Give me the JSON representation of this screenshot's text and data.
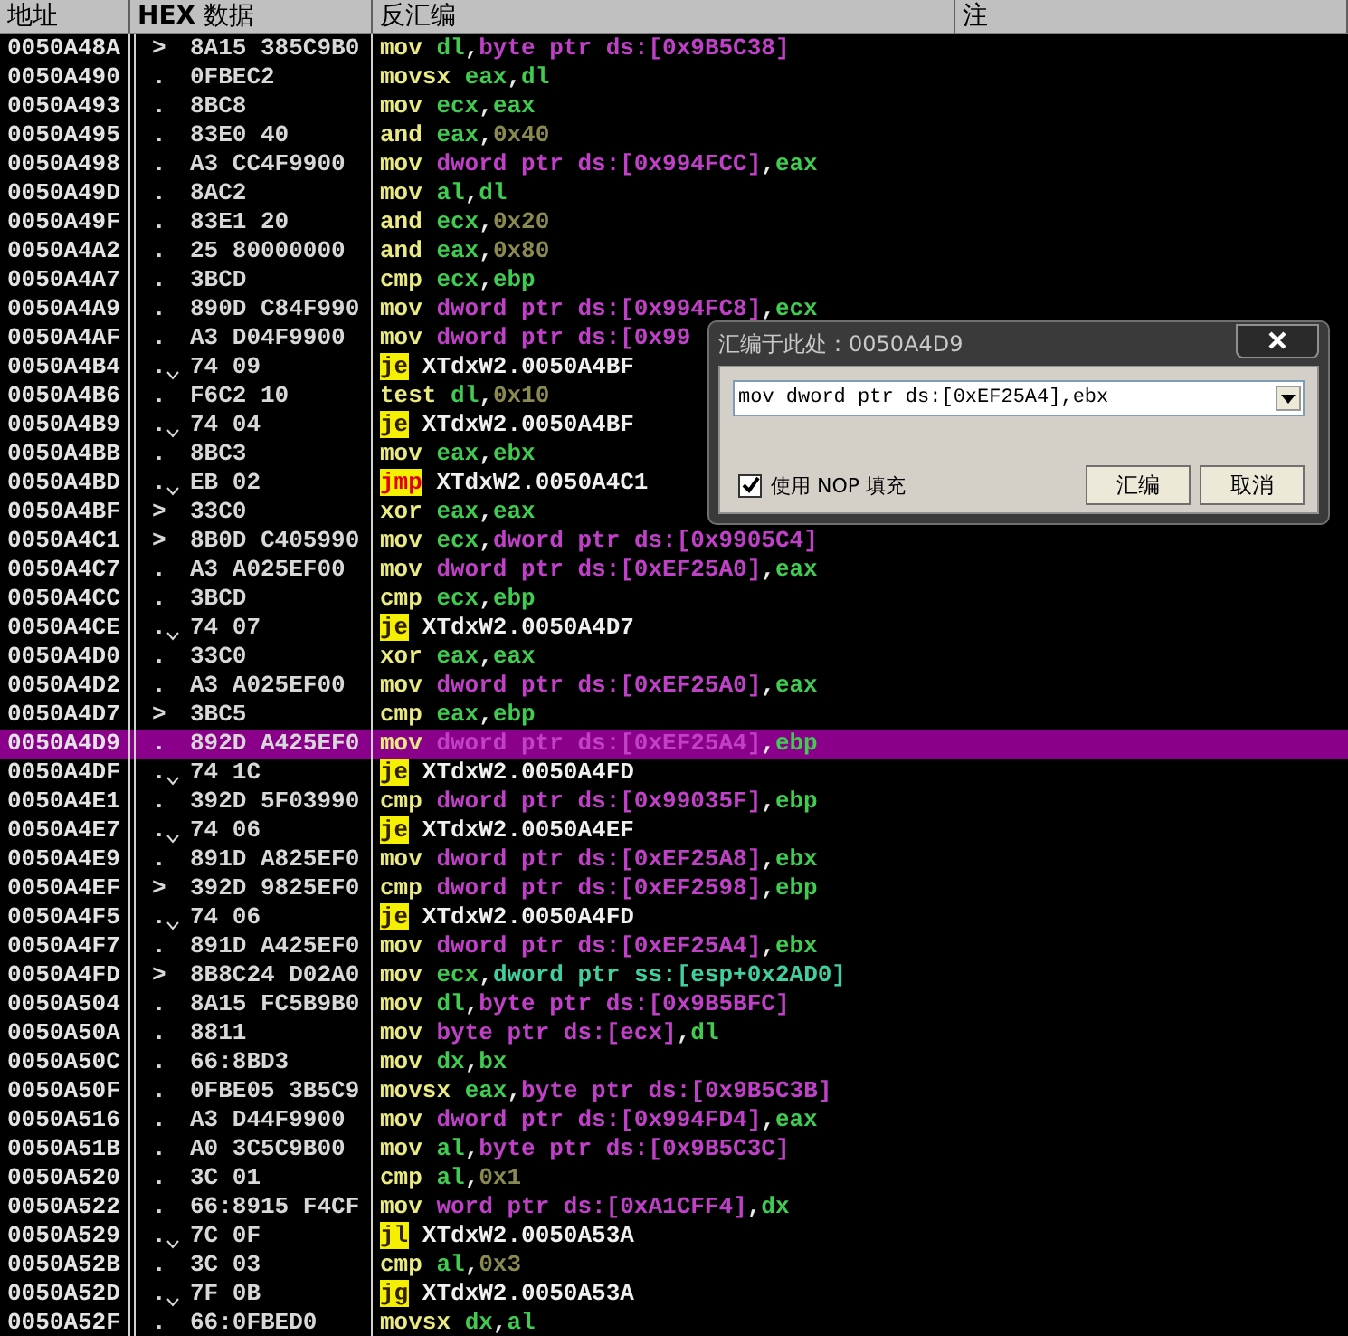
{
  "columns": [
    {
      "label": "地址"
    },
    {
      "label": "**HEX** 数据"
    },
    {
      "label": "反汇编"
    },
    {
      "label": "注"
    }
  ],
  "rows": [
    {
      "addr": "0050A48A",
      "marker": ">",
      "branch": false,
      "hex": "8A15 385C9B0",
      "selected": false,
      "asm": [
        {
          "kind": "mn",
          "text": "mov"
        },
        {
          "kind": "reg",
          "text": " dl"
        },
        {
          "kind": "p",
          "text": ","
        },
        {
          "kind": "mem",
          "text": "byte ptr ds:[0x9B5C38]"
        }
      ]
    },
    {
      "addr": "0050A490",
      "marker": ".",
      "branch": false,
      "hex": "0FBEC2",
      "selected": false,
      "asm": [
        {
          "kind": "mn",
          "text": "movsx"
        },
        {
          "kind": "reg",
          "text": " eax"
        },
        {
          "kind": "p",
          "text": ","
        },
        {
          "kind": "reg",
          "text": "dl"
        }
      ]
    },
    {
      "addr": "0050A493",
      "marker": ".",
      "branch": false,
      "hex": "8BC8",
      "selected": false,
      "asm": [
        {
          "kind": "mn",
          "text": "mov"
        },
        {
          "kind": "reg",
          "text": " ecx"
        },
        {
          "kind": "p",
          "text": ","
        },
        {
          "kind": "reg",
          "text": "eax"
        }
      ]
    },
    {
      "addr": "0050A495",
      "marker": ".",
      "branch": false,
      "hex": "83E0 40",
      "selected": false,
      "asm": [
        {
          "kind": "mn",
          "text": "and"
        },
        {
          "kind": "reg",
          "text": " eax"
        },
        {
          "kind": "p",
          "text": ","
        },
        {
          "kind": "imm",
          "text": "0x40"
        }
      ]
    },
    {
      "addr": "0050A498",
      "marker": ".",
      "branch": false,
      "hex": "A3 CC4F9900",
      "selected": false,
      "asm": [
        {
          "kind": "mn",
          "text": "mov"
        },
        {
          "kind": "mem",
          "text": " dword ptr ds:[0x994FCC]"
        },
        {
          "kind": "p",
          "text": ","
        },
        {
          "kind": "reg",
          "text": "eax"
        }
      ]
    },
    {
      "addr": "0050A49D",
      "marker": ".",
      "branch": false,
      "hex": "8AC2",
      "selected": false,
      "asm": [
        {
          "kind": "mn",
          "text": "mov"
        },
        {
          "kind": "reg",
          "text": " al"
        },
        {
          "kind": "p",
          "text": ","
        },
        {
          "kind": "reg",
          "text": "dl"
        }
      ]
    },
    {
      "addr": "0050A49F",
      "marker": ".",
      "branch": false,
      "hex": "83E1 20",
      "selected": false,
      "asm": [
        {
          "kind": "mn",
          "text": "and"
        },
        {
          "kind": "reg",
          "text": " ecx"
        },
        {
          "kind": "p",
          "text": ","
        },
        {
          "kind": "imm",
          "text": "0x20"
        }
      ]
    },
    {
      "addr": "0050A4A2",
      "marker": ".",
      "branch": false,
      "hex": "25 80000000",
      "selected": false,
      "asm": [
        {
          "kind": "mn",
          "text": "and"
        },
        {
          "kind": "reg",
          "text": " eax"
        },
        {
          "kind": "p",
          "text": ","
        },
        {
          "kind": "imm",
          "text": "0x80"
        }
      ]
    },
    {
      "addr": "0050A4A7",
      "marker": ".",
      "branch": false,
      "hex": "3BCD",
      "selected": false,
      "asm": [
        {
          "kind": "mn",
          "text": "cmp"
        },
        {
          "kind": "reg",
          "text": " ecx"
        },
        {
          "kind": "p",
          "text": ","
        },
        {
          "kind": "reg",
          "text": "ebp"
        }
      ]
    },
    {
      "addr": "0050A4A9",
      "marker": ".",
      "branch": false,
      "hex": "890D C84F990",
      "selected": false,
      "asm": [
        {
          "kind": "mn",
          "text": "mov"
        },
        {
          "kind": "mem",
          "text": " dword ptr ds:[0x994FC8]"
        },
        {
          "kind": "p",
          "text": ","
        },
        {
          "kind": "reg",
          "text": "ecx"
        }
      ]
    },
    {
      "addr": "0050A4AF",
      "marker": ".",
      "branch": false,
      "hex": "A3 D04F9900",
      "selected": false,
      "asm": [
        {
          "kind": "mn",
          "text": "mov"
        },
        {
          "kind": "mem",
          "text": " dword ptr ds:[0x99"
        }
      ]
    },
    {
      "addr": "0050A4B4",
      "marker": ".",
      "branch": true,
      "hex": "74 09",
      "selected": false,
      "asm": [
        {
          "kind": "jcc",
          "text": "je"
        },
        {
          "kind": "tgt",
          "text": " XTdxW2.0050A4BF"
        }
      ]
    },
    {
      "addr": "0050A4B6",
      "marker": ".",
      "branch": false,
      "hex": "F6C2 10",
      "selected": false,
      "asm": [
        {
          "kind": "mn",
          "text": "test"
        },
        {
          "kind": "reg",
          "text": " dl"
        },
        {
          "kind": "p",
          "text": ","
        },
        {
          "kind": "imm",
          "text": "0x10"
        }
      ]
    },
    {
      "addr": "0050A4B9",
      "marker": ".",
      "branch": true,
      "hex": "74 04",
      "selected": false,
      "asm": [
        {
          "kind": "jcc",
          "text": "je"
        },
        {
          "kind": "tgt",
          "text": " XTdxW2.0050A4BF"
        }
      ]
    },
    {
      "addr": "0050A4BB",
      "marker": ".",
      "branch": false,
      "hex": "8BC3",
      "selected": false,
      "asm": [
        {
          "kind": "mn",
          "text": "mov"
        },
        {
          "kind": "reg",
          "text": " eax"
        },
        {
          "kind": "p",
          "text": ","
        },
        {
          "kind": "reg",
          "text": "ebx"
        }
      ]
    },
    {
      "addr": "0050A4BD",
      "marker": ".",
      "branch": true,
      "hex": "EB 02",
      "selected": false,
      "asm": [
        {
          "kind": "jmp",
          "text": "jmp"
        },
        {
          "kind": "tgt",
          "text": " XTdxW2.0050A4C1"
        }
      ]
    },
    {
      "addr": "0050A4BF",
      "marker": ">",
      "branch": false,
      "hex": "33C0",
      "selected": false,
      "asm": [
        {
          "kind": "mn",
          "text": "xor"
        },
        {
          "kind": "reg",
          "text": " eax"
        },
        {
          "kind": "p",
          "text": ","
        },
        {
          "kind": "reg",
          "text": "eax"
        }
      ]
    },
    {
      "addr": "0050A4C1",
      "marker": ">",
      "branch": false,
      "hex": "8B0D C405990",
      "selected": false,
      "asm": [
        {
          "kind": "mn",
          "text": "mov"
        },
        {
          "kind": "reg",
          "text": " ecx"
        },
        {
          "kind": "p",
          "text": ","
        },
        {
          "kind": "mem",
          "text": "dword ptr ds:[0x9905C4]"
        }
      ]
    },
    {
      "addr": "0050A4C7",
      "marker": ".",
      "branch": false,
      "hex": "A3 A025EF00",
      "selected": false,
      "asm": [
        {
          "kind": "mn",
          "text": "mov"
        },
        {
          "kind": "mem",
          "text": " dword ptr ds:[0xEF25A0]"
        },
        {
          "kind": "p",
          "text": ","
        },
        {
          "kind": "reg",
          "text": "eax"
        }
      ]
    },
    {
      "addr": "0050A4CC",
      "marker": ".",
      "branch": false,
      "hex": "3BCD",
      "selected": false,
      "asm": [
        {
          "kind": "mn",
          "text": "cmp"
        },
        {
          "kind": "reg",
          "text": " ecx"
        },
        {
          "kind": "p",
          "text": ","
        },
        {
          "kind": "reg",
          "text": "ebp"
        }
      ]
    },
    {
      "addr": "0050A4CE",
      "marker": ".",
      "branch": true,
      "hex": "74 07",
      "selected": false,
      "asm": [
        {
          "kind": "jcc",
          "text": "je"
        },
        {
          "kind": "tgt",
          "text": " XTdxW2.0050A4D7"
        }
      ]
    },
    {
      "addr": "0050A4D0",
      "marker": ".",
      "branch": false,
      "hex": "33C0",
      "selected": false,
      "asm": [
        {
          "kind": "mn",
          "text": "xor"
        },
        {
          "kind": "reg",
          "text": " eax"
        },
        {
          "kind": "p",
          "text": ","
        },
        {
          "kind": "reg",
          "text": "eax"
        }
      ]
    },
    {
      "addr": "0050A4D2",
      "marker": ".",
      "branch": false,
      "hex": "A3 A025EF00",
      "selected": false,
      "asm": [
        {
          "kind": "mn",
          "text": "mov"
        },
        {
          "kind": "mem",
          "text": " dword ptr ds:[0xEF25A0]"
        },
        {
          "kind": "p",
          "text": ","
        },
        {
          "kind": "reg",
          "text": "eax"
        }
      ]
    },
    {
      "addr": "0050A4D7",
      "marker": ">",
      "branch": false,
      "hex": "3BC5",
      "selected": false,
      "asm": [
        {
          "kind": "mn",
          "text": "cmp"
        },
        {
          "kind": "reg",
          "text": " eax"
        },
        {
          "kind": "p",
          "text": ","
        },
        {
          "kind": "reg",
          "text": "ebp"
        }
      ]
    },
    {
      "addr": "0050A4D9",
      "marker": ".",
      "branch": false,
      "hex": "892D A425EF0",
      "selected": true,
      "asm": [
        {
          "kind": "mn",
          "text": "mov"
        },
        {
          "kind": "mem",
          "text": " dword ptr ds:[0xEF25A4]"
        },
        {
          "kind": "p",
          "text": ","
        },
        {
          "kind": "reg",
          "text": "ebp"
        }
      ]
    },
    {
      "addr": "0050A4DF",
      "marker": ".",
      "branch": true,
      "hex": "74 1C",
      "selected": false,
      "asm": [
        {
          "kind": "jcc",
          "text": "je"
        },
        {
          "kind": "tgt",
          "text": " XTdxW2.0050A4FD"
        }
      ]
    },
    {
      "addr": "0050A4E1",
      "marker": ".",
      "branch": false,
      "hex": "392D 5F03990",
      "selected": false,
      "asm": [
        {
          "kind": "mn",
          "text": "cmp"
        },
        {
          "kind": "mem",
          "text": " dword ptr ds:[0x99035F]"
        },
        {
          "kind": "p",
          "text": ","
        },
        {
          "kind": "reg",
          "text": "ebp"
        }
      ]
    },
    {
      "addr": "0050A4E7",
      "marker": ".",
      "branch": true,
      "hex": "74 06",
      "selected": false,
      "asm": [
        {
          "kind": "jcc",
          "text": "je"
        },
        {
          "kind": "tgt",
          "text": " XTdxW2.0050A4EF"
        }
      ]
    },
    {
      "addr": "0050A4E9",
      "marker": ".",
      "branch": false,
      "hex": "891D A825EF0",
      "selected": false,
      "asm": [
        {
          "kind": "mn",
          "text": "mov"
        },
        {
          "kind": "mem",
          "text": " dword ptr ds:[0xEF25A8]"
        },
        {
          "kind": "p",
          "text": ","
        },
        {
          "kind": "reg",
          "text": "ebx"
        }
      ]
    },
    {
      "addr": "0050A4EF",
      "marker": ">",
      "branch": false,
      "hex": "392D 9825EF0",
      "selected": false,
      "asm": [
        {
          "kind": "mn",
          "text": "cmp"
        },
        {
          "kind": "mem",
          "text": " dword ptr ds:[0xEF2598]"
        },
        {
          "kind": "p",
          "text": ","
        },
        {
          "kind": "reg",
          "text": "ebp"
        }
      ]
    },
    {
      "addr": "0050A4F5",
      "marker": ".",
      "branch": true,
      "hex": "74 06",
      "selected": false,
      "asm": [
        {
          "kind": "jcc",
          "text": "je"
        },
        {
          "kind": "tgt",
          "text": " XTdxW2.0050A4FD"
        }
      ]
    },
    {
      "addr": "0050A4F7",
      "marker": ".",
      "branch": false,
      "hex": "891D A425EF0",
      "selected": false,
      "asm": [
        {
          "kind": "mn",
          "text": "mov"
        },
        {
          "kind": "mem",
          "text": " dword ptr ds:[0xEF25A4]"
        },
        {
          "kind": "p",
          "text": ","
        },
        {
          "kind": "reg",
          "text": "ebx"
        }
      ]
    },
    {
      "addr": "0050A4FD",
      "marker": ">",
      "branch": false,
      "hex": "8B8C24 D02A0",
      "selected": false,
      "asm": [
        {
          "kind": "mn",
          "text": "mov"
        },
        {
          "kind": "reg",
          "text": " ecx"
        },
        {
          "kind": "p",
          "text": ","
        },
        {
          "kind": "stk",
          "text": "dword ptr ss:[esp+0x2AD0]"
        }
      ]
    },
    {
      "addr": "0050A504",
      "marker": ".",
      "branch": false,
      "hex": "8A15 FC5B9B0",
      "selected": false,
      "asm": [
        {
          "kind": "mn",
          "text": "mov"
        },
        {
          "kind": "reg",
          "text": " dl"
        },
        {
          "kind": "p",
          "text": ","
        },
        {
          "kind": "mem",
          "text": "byte ptr ds:[0x9B5BFC]"
        }
      ]
    },
    {
      "addr": "0050A50A",
      "marker": ".",
      "branch": false,
      "hex": "8811",
      "selected": false,
      "asm": [
        {
          "kind": "mn",
          "text": "mov"
        },
        {
          "kind": "mem",
          "text": " byte ptr ds:[ecx]"
        },
        {
          "kind": "p",
          "text": ","
        },
        {
          "kind": "reg",
          "text": "dl"
        }
      ]
    },
    {
      "addr": "0050A50C",
      "marker": ".",
      "branch": false,
      "hex": "66:8BD3",
      "selected": false,
      "asm": [
        {
          "kind": "mn",
          "text": "mov"
        },
        {
          "kind": "reg",
          "text": " dx"
        },
        {
          "kind": "p",
          "text": ","
        },
        {
          "kind": "reg",
          "text": "bx"
        }
      ]
    },
    {
      "addr": "0050A50F",
      "marker": ".",
      "branch": false,
      "hex": "0FBE05 3B5C9",
      "selected": false,
      "asm": [
        {
          "kind": "mn",
          "text": "movsx"
        },
        {
          "kind": "reg",
          "text": " eax"
        },
        {
          "kind": "p",
          "text": ","
        },
        {
          "kind": "mem",
          "text": "byte ptr ds:[0x9B5C3B]"
        }
      ]
    },
    {
      "addr": "0050A516",
      "marker": ".",
      "branch": false,
      "hex": "A3 D44F9900",
      "selected": false,
      "asm": [
        {
          "kind": "mn",
          "text": "mov"
        },
        {
          "kind": "mem",
          "text": " dword ptr ds:[0x994FD4]"
        },
        {
          "kind": "p",
          "text": ","
        },
        {
          "kind": "reg",
          "text": "eax"
        }
      ]
    },
    {
      "addr": "0050A51B",
      "marker": ".",
      "branch": false,
      "hex": "A0 3C5C9B00",
      "selected": false,
      "asm": [
        {
          "kind": "mn",
          "text": "mov"
        },
        {
          "kind": "reg",
          "text": " al"
        },
        {
          "kind": "p",
          "text": ","
        },
        {
          "kind": "mem",
          "text": "byte ptr ds:[0x9B5C3C]"
        }
      ]
    },
    {
      "addr": "0050A520",
      "marker": ".",
      "branch": false,
      "hex": "3C 01",
      "selected": false,
      "asm": [
        {
          "kind": "mn",
          "text": "cmp"
        },
        {
          "kind": "reg",
          "text": " al"
        },
        {
          "kind": "p",
          "text": ","
        },
        {
          "kind": "imm",
          "text": "0x1"
        }
      ]
    },
    {
      "addr": "0050A522",
      "marker": ".",
      "branch": false,
      "hex": "66:8915 F4CF",
      "selected": false,
      "asm": [
        {
          "kind": "mn",
          "text": "mov"
        },
        {
          "kind": "mem",
          "text": " word ptr ds:[0xA1CFF4]"
        },
        {
          "kind": "p",
          "text": ","
        },
        {
          "kind": "reg",
          "text": "dx"
        }
      ]
    },
    {
      "addr": "0050A529",
      "marker": ".",
      "branch": true,
      "hex": "7C 0F",
      "selected": false,
      "asm": [
        {
          "kind": "jcc",
          "text": "jl"
        },
        {
          "kind": "tgt",
          "text": " XTdxW2.0050A53A"
        }
      ]
    },
    {
      "addr": "0050A52B",
      "marker": ".",
      "branch": false,
      "hex": "3C 03",
      "selected": false,
      "asm": [
        {
          "kind": "mn",
          "text": "cmp"
        },
        {
          "kind": "reg",
          "text": " al"
        },
        {
          "kind": "p",
          "text": ","
        },
        {
          "kind": "imm",
          "text": "0x3"
        }
      ]
    },
    {
      "addr": "0050A52D",
      "marker": ".",
      "branch": true,
      "hex": "7F 0B",
      "selected": false,
      "asm": [
        {
          "kind": "jcc",
          "text": "jg"
        },
        {
          "kind": "tgt",
          "text": " XTdxW2.0050A53A"
        }
      ]
    },
    {
      "addr": "0050A52F",
      "marker": ".",
      "branch": false,
      "hex": "66:0FBED0",
      "selected": false,
      "asm": [
        {
          "kind": "mn",
          "text": "movsx"
        },
        {
          "kind": "reg",
          "text": " dx"
        },
        {
          "kind": "p",
          "text": ","
        },
        {
          "kind": "reg",
          "text": "al"
        }
      ]
    }
  ],
  "dialog": {
    "title": "汇编于此处：0050A4D9",
    "value": "mov dword ptr ds:[0xEF25A4],ebx",
    "checkbox": {
      "label": "使用 NOP 填充",
      "checked": true
    },
    "buttons": [
      "汇编",
      "取消"
    ]
  }
}
